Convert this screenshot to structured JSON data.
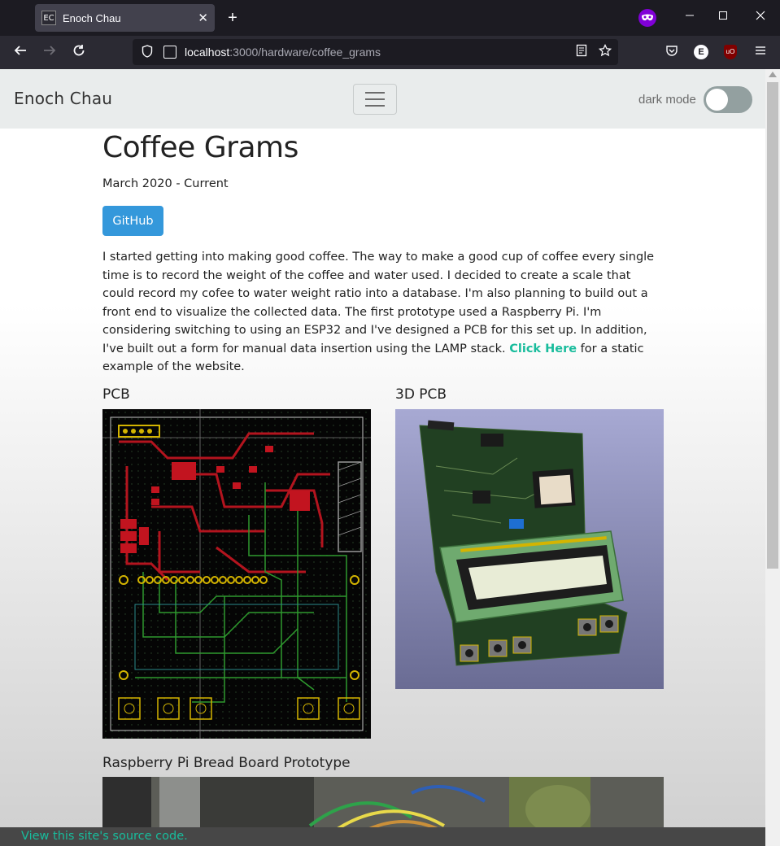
{
  "browser": {
    "tab_favicon": "EC",
    "tab_title": "Enoch Chau",
    "tab_close": "✕",
    "new_tab": "+",
    "url_host": "localhost",
    "url_path": ":3000/hardware/coffee_grams",
    "account_initial": "E",
    "ublock_label": "uO"
  },
  "site": {
    "brand": "Enoch Chau",
    "dark_mode_label": "dark mode",
    "dark_mode_on": false
  },
  "page": {
    "title": "Coffee Grams",
    "date": "March 2020 - Current",
    "github_label": "GitHub",
    "description": "I started getting into making good coffee. The way to make a good cup of coffee every single time is to record the weight of the coffee and water used. I decided to create a scale that could record my cofee to water weight ratio into a database. I'm also planning to build out a front end to visualize the collected data. The first prototype used a Raspberry Pi. I'm considering switching to using an ESP32 and I've designed a PCB for this set up. In addition, I've built out a form for manual data insertion using the LAMP stack.",
    "click_here": "Click Here",
    "description_tail": " for a static example of the website.",
    "pcb_label": "PCB",
    "pcb3d_label": "3D PCB",
    "proto_label": "Raspberry Pi Bread Board Prototype"
  },
  "footer": {
    "source_link": "View this site's source code."
  }
}
